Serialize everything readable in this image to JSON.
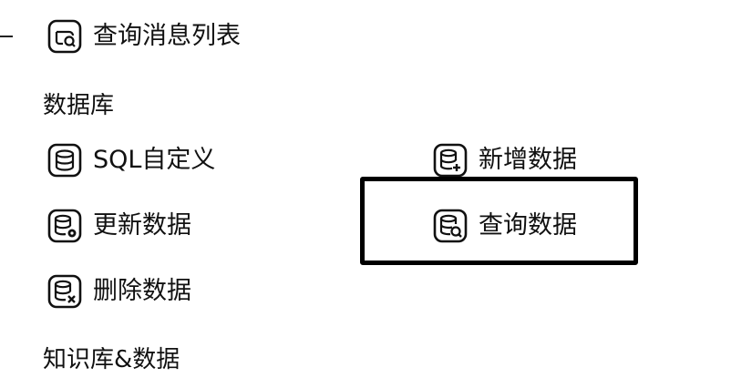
{
  "items": {
    "query_message_list": {
      "label": "查询消息列表",
      "icon": "message-search-icon"
    },
    "sql_custom": {
      "label": "SQL自定义",
      "icon": "database-icon"
    },
    "add_data": {
      "label": "新增数据",
      "icon": "database-add-icon"
    },
    "update_data": {
      "label": "更新数据",
      "icon": "database-update-icon"
    },
    "query_data": {
      "label": "查询数据",
      "icon": "database-search-icon"
    },
    "delete_data": {
      "label": "删除数据",
      "icon": "database-delete-icon"
    }
  },
  "sections": {
    "database": "数据库",
    "knowledge": "知识库&数据"
  },
  "highlight": {
    "target": "query_data",
    "color": "#000000"
  }
}
